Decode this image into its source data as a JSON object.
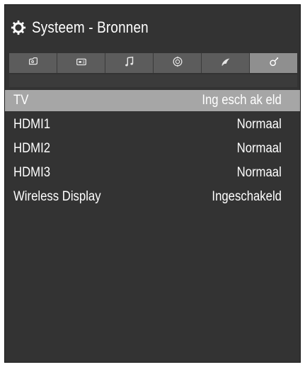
{
  "header": {
    "title": "Systeem - Bronnen",
    "icon": "gear-icon"
  },
  "tabs": [
    {
      "icon": "picture-icon",
      "active": false
    },
    {
      "icon": "sound-icon",
      "active": false
    },
    {
      "icon": "music-note-icon",
      "active": false
    },
    {
      "icon": "network-icon",
      "active": false
    },
    {
      "icon": "satellite-icon",
      "active": false
    },
    {
      "icon": "settings-icon",
      "active": true
    }
  ],
  "sources": [
    {
      "name": "TV",
      "value": "Ing esch ak eld",
      "selected": true
    },
    {
      "name": "HDMI1",
      "value": "Normaal",
      "selected": false
    },
    {
      "name": "HDMI2",
      "value": "Normaal",
      "selected": false
    },
    {
      "name": "HDMI3",
      "value": "Normaal",
      "selected": false
    },
    {
      "name": "Wireless Display",
      "value": "Ingeschakeld",
      "selected": false
    }
  ],
  "colors": {
    "background": "#333333",
    "tabbar": "#5c5c5c",
    "tab_active": "#8f8f8f",
    "selected_row": "#a6a6a6",
    "text": "#ffffff"
  }
}
